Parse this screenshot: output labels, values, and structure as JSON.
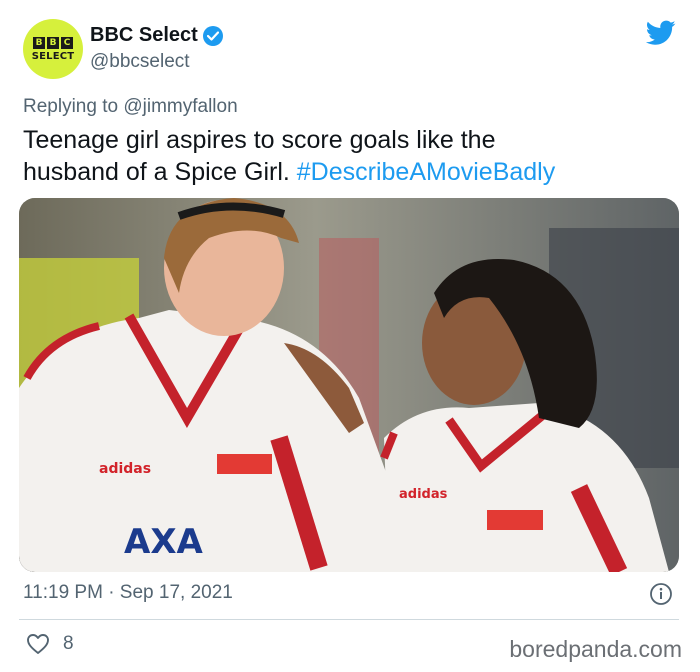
{
  "account": {
    "avatar_word": "SELECT",
    "avatar_blocks": [
      "B",
      "B",
      "C"
    ],
    "display_name": "BBC Select",
    "handle": "@bbcselect",
    "verified": true,
    "accent_color": "#d6f03c"
  },
  "tweet": {
    "replying_prefix": "Replying to ",
    "replying_to": "@jimmyfallon",
    "text_line1": "Teenage girl aspires to score goals like the",
    "text_line2": "husband of a Spice Girl. ",
    "hashtag": "#DescribeAMovieBadly",
    "hashtag_color": "#1d9bf0"
  },
  "photo": {
    "shirt_brand_1": "adidas",
    "shirt_sponsor": "AXA",
    "shirt_brand_2": "adidas"
  },
  "meta": {
    "timestamp": "11:19 PM · Sep 17, 2021",
    "like_count": "8"
  },
  "icons": {
    "brand": "twitter-bird-icon",
    "verified": "verified-badge-icon",
    "info": "info-icon",
    "like": "heart-icon"
  },
  "watermark": "boredpanda.com"
}
